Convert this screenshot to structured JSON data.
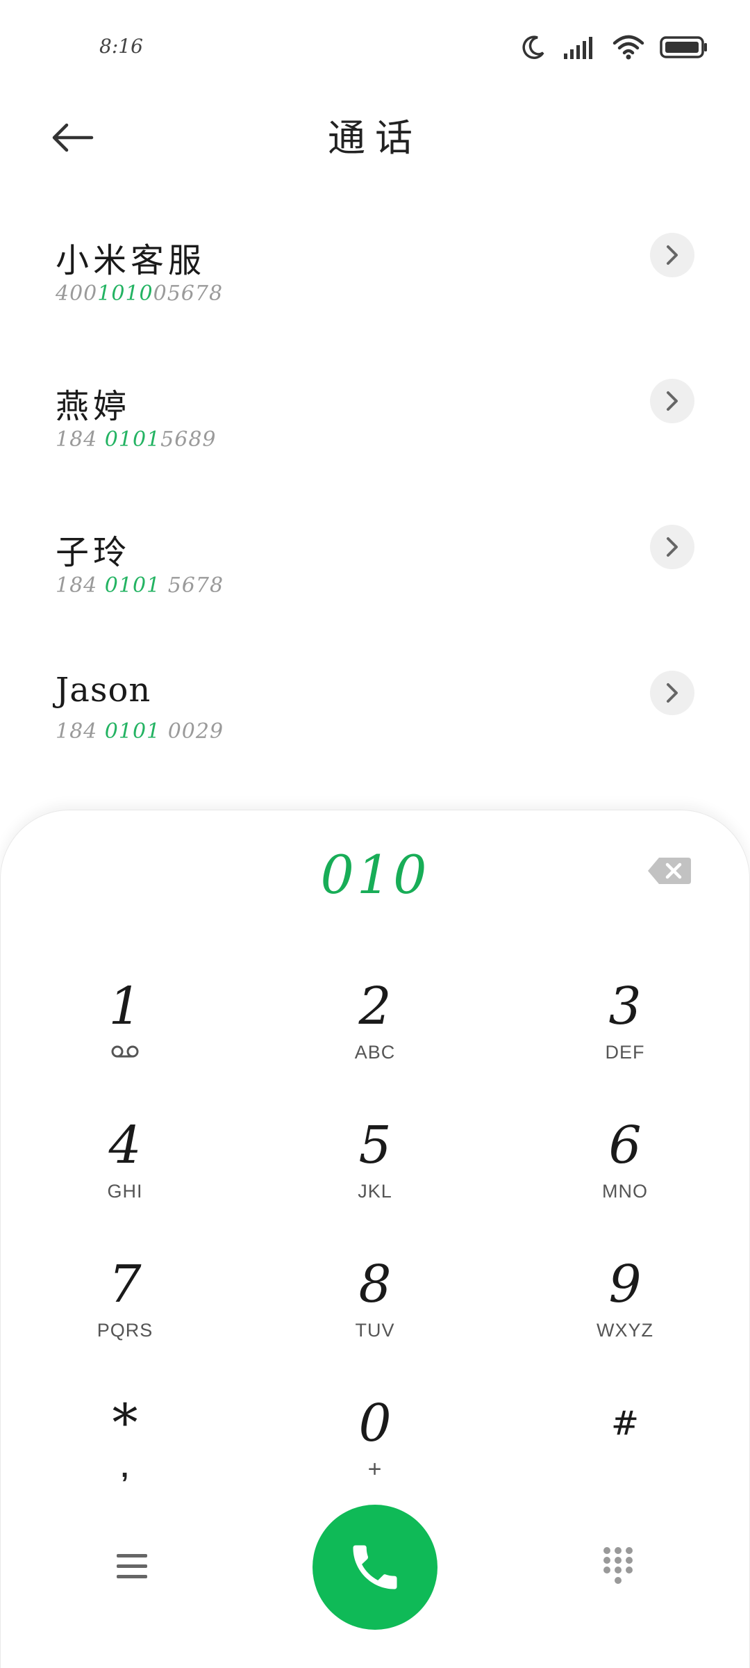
{
  "status_bar": {
    "time": "8:16"
  },
  "header": {
    "title": "通话"
  },
  "contacts": [
    {
      "name": "小米客服",
      "number_pre": "400",
      "number_hl": "1010",
      "number_post": "05678"
    },
    {
      "name": "燕婷",
      "number_pre": "184 ",
      "number_hl": "0101",
      "number_post": "5689"
    },
    {
      "name": "子玲",
      "number_pre": "184 ",
      "number_hl": "0101",
      "number_post": " 5678"
    },
    {
      "name": "Jason",
      "number_pre": "184 ",
      "number_hl": "0101",
      "number_post": " 0029"
    }
  ],
  "dialpad": {
    "entered_digits": "010",
    "keys": [
      {
        "digit": "1",
        "letters": "",
        "sub_icon": "voicemail-icon"
      },
      {
        "digit": "2",
        "letters": "ABC"
      },
      {
        "digit": "3",
        "letters": "DEF"
      },
      {
        "digit": "4",
        "letters": "GHI"
      },
      {
        "digit": "5",
        "letters": "JKL"
      },
      {
        "digit": "6",
        "letters": "MNO"
      },
      {
        "digit": "7",
        "letters": "PQRS"
      },
      {
        "digit": "8",
        "letters": "TUV"
      },
      {
        "digit": "9",
        "letters": "WXYZ"
      },
      {
        "digit": "*",
        "letters": ","
      },
      {
        "digit": "0",
        "letters": "+"
      },
      {
        "digit": "#",
        "letters": ""
      }
    ]
  },
  "colors": {
    "accent": "#18ad57",
    "call_button": "#0fba57"
  }
}
